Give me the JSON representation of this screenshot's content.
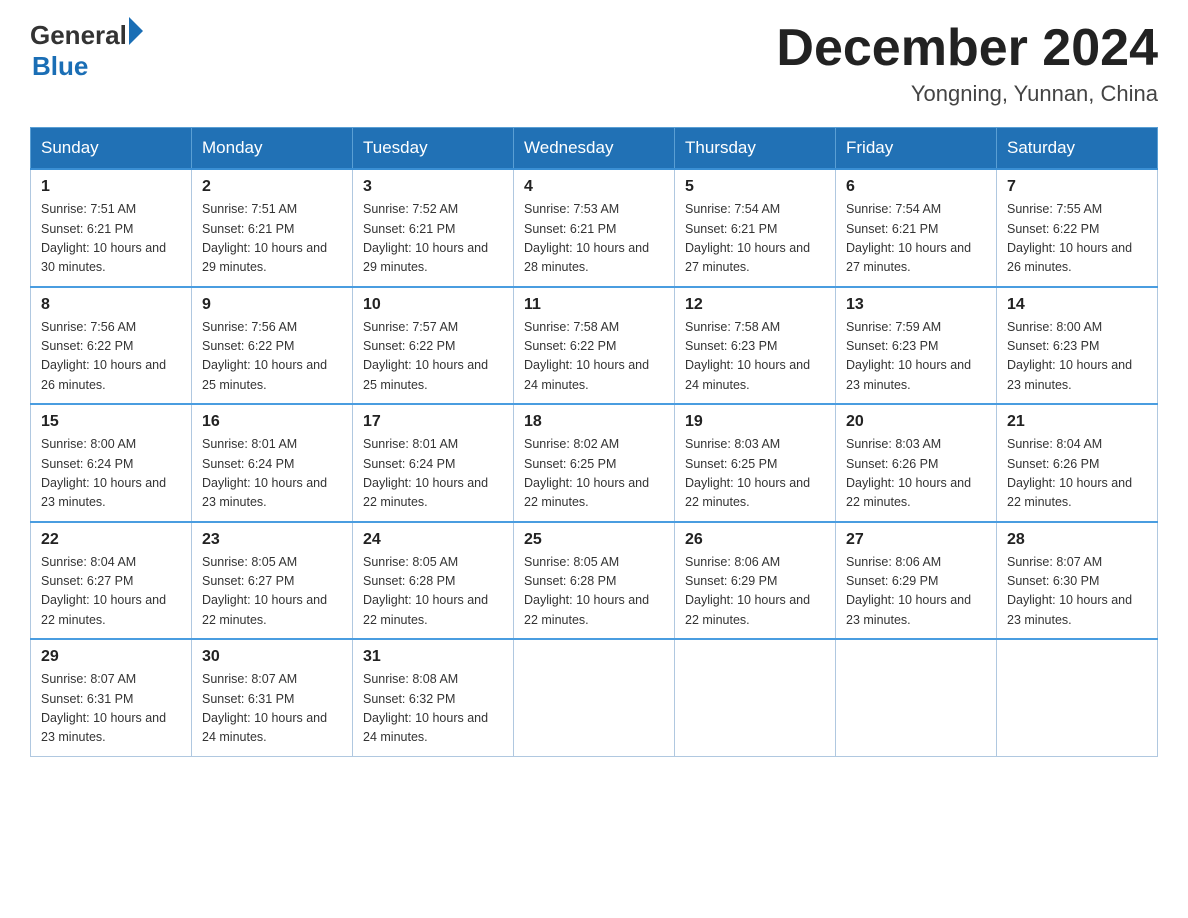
{
  "header": {
    "logo_general": "General",
    "logo_blue": "Blue",
    "month_title": "December 2024",
    "location": "Yongning, Yunnan, China"
  },
  "days_of_week": [
    "Sunday",
    "Monday",
    "Tuesday",
    "Wednesday",
    "Thursday",
    "Friday",
    "Saturday"
  ],
  "weeks": [
    [
      {
        "day": "1",
        "sunrise": "7:51 AM",
        "sunset": "6:21 PM",
        "daylight": "10 hours and 30 minutes."
      },
      {
        "day": "2",
        "sunrise": "7:51 AM",
        "sunset": "6:21 PM",
        "daylight": "10 hours and 29 minutes."
      },
      {
        "day": "3",
        "sunrise": "7:52 AM",
        "sunset": "6:21 PM",
        "daylight": "10 hours and 29 minutes."
      },
      {
        "day": "4",
        "sunrise": "7:53 AM",
        "sunset": "6:21 PM",
        "daylight": "10 hours and 28 minutes."
      },
      {
        "day": "5",
        "sunrise": "7:54 AM",
        "sunset": "6:21 PM",
        "daylight": "10 hours and 27 minutes."
      },
      {
        "day": "6",
        "sunrise": "7:54 AM",
        "sunset": "6:21 PM",
        "daylight": "10 hours and 27 minutes."
      },
      {
        "day": "7",
        "sunrise": "7:55 AM",
        "sunset": "6:22 PM",
        "daylight": "10 hours and 26 minutes."
      }
    ],
    [
      {
        "day": "8",
        "sunrise": "7:56 AM",
        "sunset": "6:22 PM",
        "daylight": "10 hours and 26 minutes."
      },
      {
        "day": "9",
        "sunrise": "7:56 AM",
        "sunset": "6:22 PM",
        "daylight": "10 hours and 25 minutes."
      },
      {
        "day": "10",
        "sunrise": "7:57 AM",
        "sunset": "6:22 PM",
        "daylight": "10 hours and 25 minutes."
      },
      {
        "day": "11",
        "sunrise": "7:58 AM",
        "sunset": "6:22 PM",
        "daylight": "10 hours and 24 minutes."
      },
      {
        "day": "12",
        "sunrise": "7:58 AM",
        "sunset": "6:23 PM",
        "daylight": "10 hours and 24 minutes."
      },
      {
        "day": "13",
        "sunrise": "7:59 AM",
        "sunset": "6:23 PM",
        "daylight": "10 hours and 23 minutes."
      },
      {
        "day": "14",
        "sunrise": "8:00 AM",
        "sunset": "6:23 PM",
        "daylight": "10 hours and 23 minutes."
      }
    ],
    [
      {
        "day": "15",
        "sunrise": "8:00 AM",
        "sunset": "6:24 PM",
        "daylight": "10 hours and 23 minutes."
      },
      {
        "day": "16",
        "sunrise": "8:01 AM",
        "sunset": "6:24 PM",
        "daylight": "10 hours and 23 minutes."
      },
      {
        "day": "17",
        "sunrise": "8:01 AM",
        "sunset": "6:24 PM",
        "daylight": "10 hours and 22 minutes."
      },
      {
        "day": "18",
        "sunrise": "8:02 AM",
        "sunset": "6:25 PM",
        "daylight": "10 hours and 22 minutes."
      },
      {
        "day": "19",
        "sunrise": "8:03 AM",
        "sunset": "6:25 PM",
        "daylight": "10 hours and 22 minutes."
      },
      {
        "day": "20",
        "sunrise": "8:03 AM",
        "sunset": "6:26 PM",
        "daylight": "10 hours and 22 minutes."
      },
      {
        "day": "21",
        "sunrise": "8:04 AM",
        "sunset": "6:26 PM",
        "daylight": "10 hours and 22 minutes."
      }
    ],
    [
      {
        "day": "22",
        "sunrise": "8:04 AM",
        "sunset": "6:27 PM",
        "daylight": "10 hours and 22 minutes."
      },
      {
        "day": "23",
        "sunrise": "8:05 AM",
        "sunset": "6:27 PM",
        "daylight": "10 hours and 22 minutes."
      },
      {
        "day": "24",
        "sunrise": "8:05 AM",
        "sunset": "6:28 PM",
        "daylight": "10 hours and 22 minutes."
      },
      {
        "day": "25",
        "sunrise": "8:05 AM",
        "sunset": "6:28 PM",
        "daylight": "10 hours and 22 minutes."
      },
      {
        "day": "26",
        "sunrise": "8:06 AM",
        "sunset": "6:29 PM",
        "daylight": "10 hours and 22 minutes."
      },
      {
        "day": "27",
        "sunrise": "8:06 AM",
        "sunset": "6:29 PM",
        "daylight": "10 hours and 23 minutes."
      },
      {
        "day": "28",
        "sunrise": "8:07 AM",
        "sunset": "6:30 PM",
        "daylight": "10 hours and 23 minutes."
      }
    ],
    [
      {
        "day": "29",
        "sunrise": "8:07 AM",
        "sunset": "6:31 PM",
        "daylight": "10 hours and 23 minutes."
      },
      {
        "day": "30",
        "sunrise": "8:07 AM",
        "sunset": "6:31 PM",
        "daylight": "10 hours and 24 minutes."
      },
      {
        "day": "31",
        "sunrise": "8:08 AM",
        "sunset": "6:32 PM",
        "daylight": "10 hours and 24 minutes."
      },
      null,
      null,
      null,
      null
    ]
  ],
  "labels": {
    "sunrise_prefix": "Sunrise: ",
    "sunset_prefix": "Sunset: ",
    "daylight_prefix": "Daylight: "
  }
}
